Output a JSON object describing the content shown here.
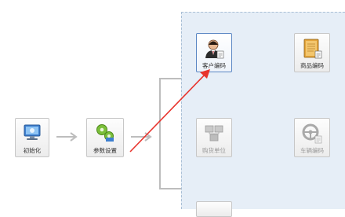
{
  "flow": {
    "init_label": "初始化",
    "params_label": "参数设置"
  },
  "panel": {
    "customer_label": "客户编码",
    "product_label": "商品编码",
    "purchase_label": "购货单位",
    "vehicle_label": "车辆编码"
  },
  "colors": {
    "annotation_arrow": "#e8332c",
    "panel_bg": "#e6eef7",
    "connector": "#bdbdbd",
    "selected_border": "#5b87c4"
  }
}
